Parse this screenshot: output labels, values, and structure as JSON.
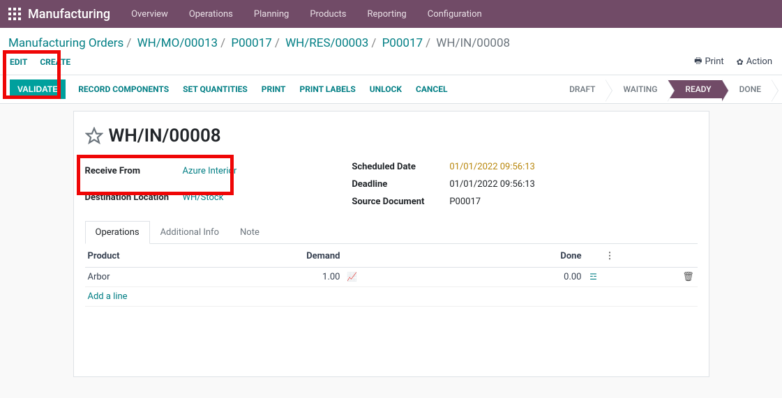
{
  "topbar": {
    "app_title": "Manufacturing",
    "menu": [
      "Overview",
      "Operations",
      "Planning",
      "Products",
      "Reporting",
      "Configuration"
    ]
  },
  "breadcrumb": {
    "items": [
      "Manufacturing Orders",
      "WH/MO/00013",
      "P00017",
      "WH/RES/00003",
      "P00017"
    ],
    "current": "WH/IN/00008"
  },
  "actions": {
    "edit": "EDIT",
    "create": "CREATE",
    "print": "Print",
    "action": "Action"
  },
  "buttons": {
    "validate": "VALIDATE",
    "record_components": "RECORD COMPONENTS",
    "set_quantities": "SET QUANTITIES",
    "print": "PRINT",
    "print_labels": "PRINT LABELS",
    "unlock": "UNLOCK",
    "cancel": "CANCEL"
  },
  "status": {
    "draft": "DRAFT",
    "waiting": "WAITING",
    "ready": "READY",
    "done": "DONE"
  },
  "doc": {
    "title": "WH/IN/00008"
  },
  "fields": {
    "receive_from_label": "Receive From",
    "receive_from_value": "Azure Interior",
    "dest_loc_label": "Destination Location",
    "dest_loc_value": "WH/Stock",
    "scheduled_label": "Scheduled Date",
    "scheduled_value": "01/01/2022 09:56:13",
    "deadline_label": "Deadline",
    "deadline_value": "01/01/2022 09:56:13",
    "source_doc_label": "Source Document",
    "source_doc_value": "P00017"
  },
  "tabs": {
    "operations": "Operations",
    "additional": "Additional Info",
    "note": "Note"
  },
  "table": {
    "headers": {
      "product": "Product",
      "demand": "Demand",
      "done": "Done"
    },
    "rows": [
      {
        "product": "Arbor",
        "demand": "1.00",
        "done": "0.00"
      }
    ],
    "add_line": "Add a line"
  }
}
